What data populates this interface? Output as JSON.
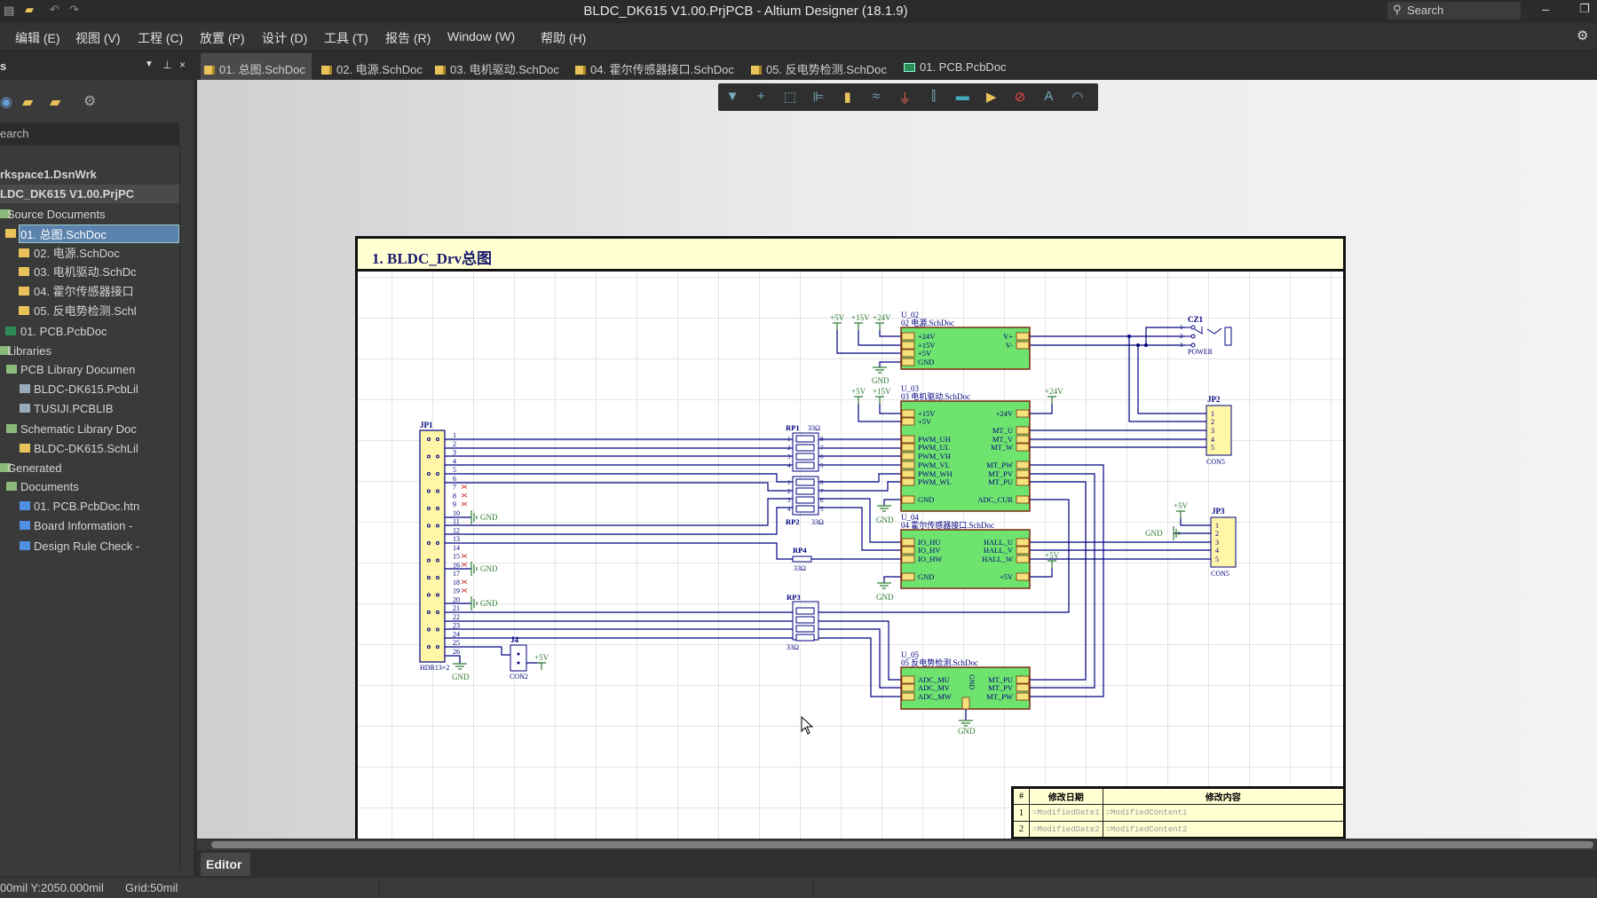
{
  "window": {
    "title": "BLDC_DK615 V1.00.PrjPCB - Altium Designer (18.1.9)",
    "search_placeholder": "Search"
  },
  "menu": [
    "编辑 (E)",
    "视图 (V)",
    "工程 (C)",
    "放置 (P)",
    "设计 (D)",
    "工具 (T)",
    "报告 (R)",
    "Window (W)",
    "帮助 (H)"
  ],
  "tabs": [
    {
      "label": "01. 总图.SchDoc",
      "active": true,
      "icon": "schdoc-icon"
    },
    {
      "label": "02. 电源.SchDoc",
      "icon": "schdoc-icon"
    },
    {
      "label": "03. 电机驱动.SchDoc",
      "icon": "schdoc-icon"
    },
    {
      "label": "04. 霍尔传感器接口.SchDoc",
      "icon": "schdoc-icon"
    },
    {
      "label": "05. 反电势检测.SchDoc",
      "icon": "schdoc-icon"
    },
    {
      "label": "01. PCB.PcbDoc",
      "icon": "pcbdoc-icon"
    }
  ],
  "panel": {
    "title": "s",
    "search_placeholder": "earch",
    "tree": [
      {
        "label": "rkspace1.DsnWrk",
        "bold": true
      },
      {
        "label": "LDC_DK615 V1.00.PrjPC",
        "bold": true
      },
      {
        "label": "Source Documents"
      },
      {
        "label": "01. 总图.SchDoc",
        "selected": true
      },
      {
        "label": "02. 电源.SchDoc"
      },
      {
        "label": "03. 电机驱动.SchDc"
      },
      {
        "label": "04. 霍尔传感器接口"
      },
      {
        "label": "05. 反电势检测.Schl"
      },
      {
        "label": "01. PCB.PcbDoc"
      },
      {
        "label": "Libraries"
      },
      {
        "label": "PCB Library Documen"
      },
      {
        "label": "BLDC-DK615.PcbLil"
      },
      {
        "label": "TUSIJI.PCBLIB"
      },
      {
        "label": "Schematic Library Doc"
      },
      {
        "label": "BLDC-DK615.SchLil"
      },
      {
        "label": "Generated"
      },
      {
        "label": "Documents"
      },
      {
        "label": "01. PCB.PcbDoc.htn"
      },
      {
        "label": "Board Information -"
      },
      {
        "label": "Design Rule Check -"
      }
    ]
  },
  "toolbar_icons": [
    "filter-icon",
    "cross-icon",
    "select-rect-icon",
    "align-icon",
    "part-icon",
    "wire-icon",
    "ground-icon",
    "bus-icon",
    "sheet-symbol-icon",
    "port-icon",
    "no-erc-icon",
    "text-icon",
    "arc-icon"
  ],
  "sheet": {
    "title": "1. BLDC_Drv总图",
    "blocks": [
      {
        "designator": "U_02",
        "file": "02 电源.SchDoc",
        "left": [
          "+24V",
          "+15V",
          "+5V",
          "GND"
        ],
        "right": [
          "V+",
          "V-"
        ]
      },
      {
        "designator": "U_03",
        "file": "03 电机驱动.SchDoc",
        "left": [
          "+15V",
          "+5V",
          "PWM_UH",
          "PWM_UL",
          "PWM_VH",
          "PWM_VL",
          "PWM_WH",
          "PWM_WL",
          "GND"
        ],
        "right": [
          "+24V",
          "MT_U",
          "MT_V",
          "MT_W",
          "MT_PW",
          "MT_PV",
          "MT_PU",
          "ADC_CUR"
        ]
      },
      {
        "designator": "U_04",
        "file": "04 霍尔传感器接口.SchDoc",
        "left": [
          "IO_HU",
          "IO_HV",
          "IO_HW",
          "GND"
        ],
        "right": [
          "HALL_U",
          "HALL_V",
          "HALL_W",
          "+5V"
        ]
      },
      {
        "designator": "U_05",
        "file": "05 反电势检测.SchDoc",
        "left": [
          "ADC_MU",
          "ADC_MV",
          "ADC_MW"
        ],
        "right": [
          "MT_PU",
          "MT_PV",
          "MT_PW"
        ],
        "bottom": "GND"
      }
    ],
    "power_labels": {
      "p5": "+5V",
      "p15": "+15V",
      "p24": "+24V",
      "gnd": "GND"
    },
    "jp1": {
      "designator": "JP1",
      "comment": "HDR13×2",
      "pins": [
        "1",
        "2",
        "3",
        "4",
        "5",
        "6",
        "7",
        "8",
        "9",
        "10",
        "11",
        "12",
        "13",
        "14",
        "15",
        "16",
        "17",
        "18",
        "19",
        "20",
        "21",
        "22",
        "23",
        "24",
        "25",
        "26"
      ]
    },
    "rp": [
      {
        "designator": "RP1",
        "value": "33Ω"
      },
      {
        "designator": "RP2",
        "value": "33Ω"
      },
      {
        "designator": "RP3",
        "value": "33Ω"
      },
      {
        "designator": "RP4",
        "value": "33Ω"
      }
    ],
    "rp_pins_left": [
      "1",
      "2",
      "3",
      "4"
    ],
    "rp_pins_right": [
      "8",
      "7",
      "6",
      "5"
    ],
    "cz1": {
      "designator": "CZ1",
      "comment": "POWER",
      "pins": [
        "1",
        "2",
        "3"
      ]
    },
    "jp2": {
      "designator": "JP2",
      "comment": "CON5",
      "pins": [
        "1",
        "2",
        "3",
        "4",
        "5"
      ]
    },
    "jp3": {
      "designator": "JP3",
      "comment": "CON5",
      "pins": [
        "1",
        "2",
        "3",
        "4",
        "5"
      ]
    },
    "j4": {
      "designator": "J4",
      "comment": "CON2"
    },
    "revision": {
      "headers": [
        "#",
        "修改日期",
        "修改内容"
      ],
      "rows": [
        [
          "1",
          "=ModifiedDate1",
          "=ModifiedContent1"
        ],
        [
          "2",
          "=ModifiedDate2",
          "=ModifiedContent2"
        ]
      ]
    }
  },
  "editor_tab": "Editor",
  "status": {
    "coords": "00mil Y:2050.000mil",
    "grid": "Grid:50mil"
  },
  "colors": {
    "wire": "#000080",
    "block_fill": "#6ee46e",
    "pin_fill": "#f6e27c",
    "power": "#2e7d32",
    "selection": "#5a82ad"
  }
}
